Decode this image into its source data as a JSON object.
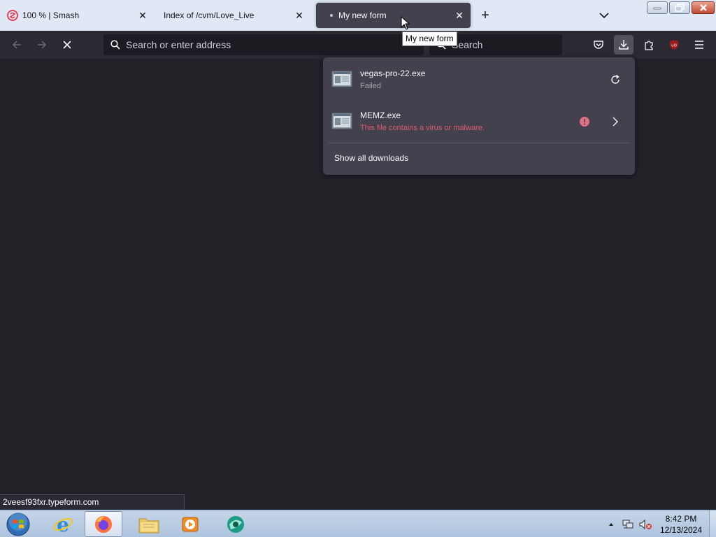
{
  "tabs": [
    {
      "title": "100 % | Smash",
      "favicon": "smash-icon"
    },
    {
      "title": "Index of /cvm/Love_Live",
      "favicon": "none"
    },
    {
      "title": "My new form",
      "favicon": "loading-dot"
    }
  ],
  "tooltip": "My new form",
  "urlbar": {
    "placeholder": "Search or enter address"
  },
  "searchbar": {
    "placeholder": "Search"
  },
  "downloads": {
    "items": [
      {
        "name": "vegas-pro-22.exe",
        "status": "Failed",
        "action": "retry-icon"
      },
      {
        "name": "MEMZ.exe",
        "status": "This file contains a virus or malware.",
        "action": "chevron-right-icon",
        "warning": "error-icon"
      }
    ],
    "show_all": "Show all downloads"
  },
  "status_link": "2veesf93fxr.typeform.com",
  "taskbar": {
    "apps": [
      "internet-explorer-icon",
      "firefox-icon",
      "file-explorer-icon",
      "media-player-icon",
      "app-icon"
    ],
    "clock": {
      "time": "8:42 PM",
      "date": "12/13/2024"
    }
  },
  "colors": {
    "accent_danger": "#e05c6e",
    "panel": "#42414d",
    "toolbar": "#2b2a33",
    "content": "#232229"
  }
}
